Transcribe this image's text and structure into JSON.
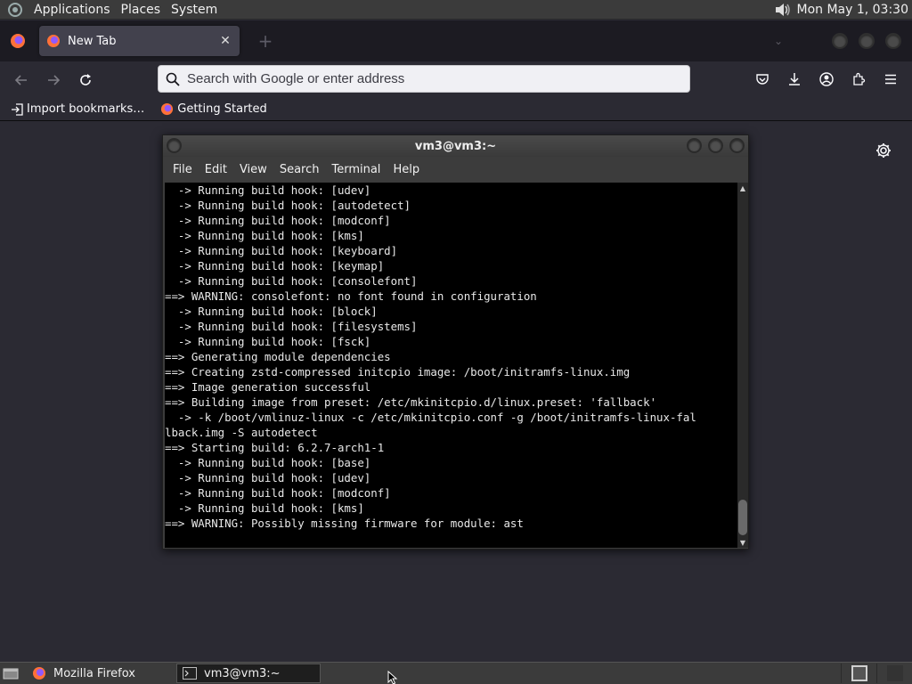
{
  "top_panel": {
    "menus": [
      "Applications",
      "Places",
      "System"
    ],
    "clock": "Mon May  1, 03:30"
  },
  "browser": {
    "tab": {
      "title": "New Tab"
    },
    "urlbar": {
      "placeholder": "Search with Google or enter address"
    },
    "bookmarks": [
      "Import bookmarks…",
      "Getting Started"
    ]
  },
  "terminal": {
    "title": "vm3@vm3:~",
    "menu": [
      "File",
      "Edit",
      "View",
      "Search",
      "Terminal",
      "Help"
    ],
    "lines": [
      "  -> Running build hook: [udev]",
      "  -> Running build hook: [autodetect]",
      "  -> Running build hook: [modconf]",
      "  -> Running build hook: [kms]",
      "  -> Running build hook: [keyboard]",
      "  -> Running build hook: [keymap]",
      "  -> Running build hook: [consolefont]",
      "==> WARNING: consolefont: no font found in configuration",
      "  -> Running build hook: [block]",
      "  -> Running build hook: [filesystems]",
      "  -> Running build hook: [fsck]",
      "==> Generating module dependencies",
      "==> Creating zstd-compressed initcpio image: /boot/initramfs-linux.img",
      "==> Image generation successful",
      "==> Building image from preset: /etc/mkinitcpio.d/linux.preset: 'fallback'",
      "  -> -k /boot/vmlinuz-linux -c /etc/mkinitcpio.conf -g /boot/initramfs-linux-fal",
      "lback.img -S autodetect",
      "==> Starting build: 6.2.7-arch1-1",
      "  -> Running build hook: [base]",
      "  -> Running build hook: [udev]",
      "  -> Running build hook: [modconf]",
      "  -> Running build hook: [kms]",
      "==> WARNING: Possibly missing firmware for module: ast"
    ]
  },
  "taskbar": {
    "tasks": [
      "Mozilla Firefox",
      "vm3@vm3:~"
    ]
  },
  "colors": {
    "browser_bg": "#2b2a33",
    "tabstrip_bg": "#1c1b22",
    "panel_bg": "#3b3b3b",
    "terminal_bg": "#000000"
  },
  "icons": {
    "top_panel": [
      "distro-logo-icon",
      "volume-icon"
    ],
    "browser": [
      "firefox-icon",
      "close-icon",
      "plus-icon",
      "chevron-down-icon",
      "back-arrow-icon",
      "forward-arrow-icon",
      "reload-icon",
      "search-icon",
      "pocket-icon",
      "download-icon",
      "account-icon",
      "extensions-icon",
      "hamburger-menu-icon",
      "import-icon",
      "gear-icon"
    ],
    "taskbar": [
      "show-desktop-icon",
      "terminal-icon"
    ]
  }
}
